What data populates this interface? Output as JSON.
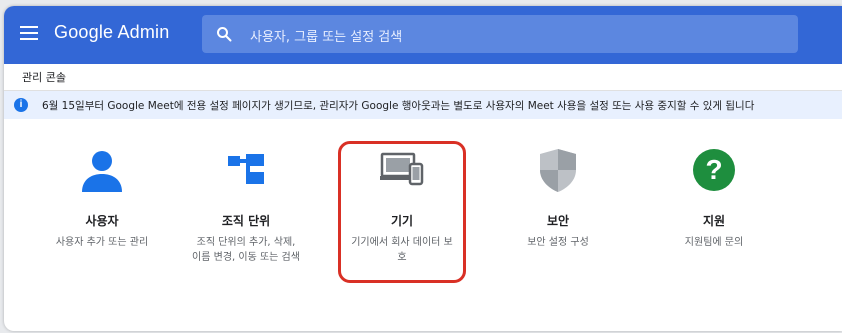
{
  "header": {
    "app_name": "Google Admin",
    "search_placeholder": "사용자, 그룹 또는 설정 검색",
    "bar_color": "#3367d6"
  },
  "breadcrumb": "관리 콘솔",
  "notice": {
    "text": "6월 15일부터 Google Meet에 전용 설정 페이지가 생기므로, 관리자가 Google 행아웃과는 별도로 사용자의 Meet 사용을 설정 또는 사용 중지할 수 있게 됩니다"
  },
  "cards": [
    {
      "title": "사용자",
      "desc": "사용자 추가 또는 관리",
      "icon": "user-icon"
    },
    {
      "title": "조직 단위",
      "desc": "조직 단위의 추가, 삭제, 이름 변경, 이동 또는 검색",
      "icon": "org-unit-icon"
    },
    {
      "title": "기기",
      "desc": "기기에서 회사 데이터 보호",
      "icon": "devices-icon",
      "highlighted": true
    },
    {
      "title": "보안",
      "desc": "보안 설정 구성",
      "icon": "shield-icon"
    },
    {
      "title": "지원",
      "desc": "지원팀에 문의",
      "icon": "help-icon"
    }
  ],
  "colors": {
    "highlight": "#d93025",
    "user": "#1a73e8",
    "help": "#1e8e3e",
    "shield": "#9aa0a6"
  }
}
